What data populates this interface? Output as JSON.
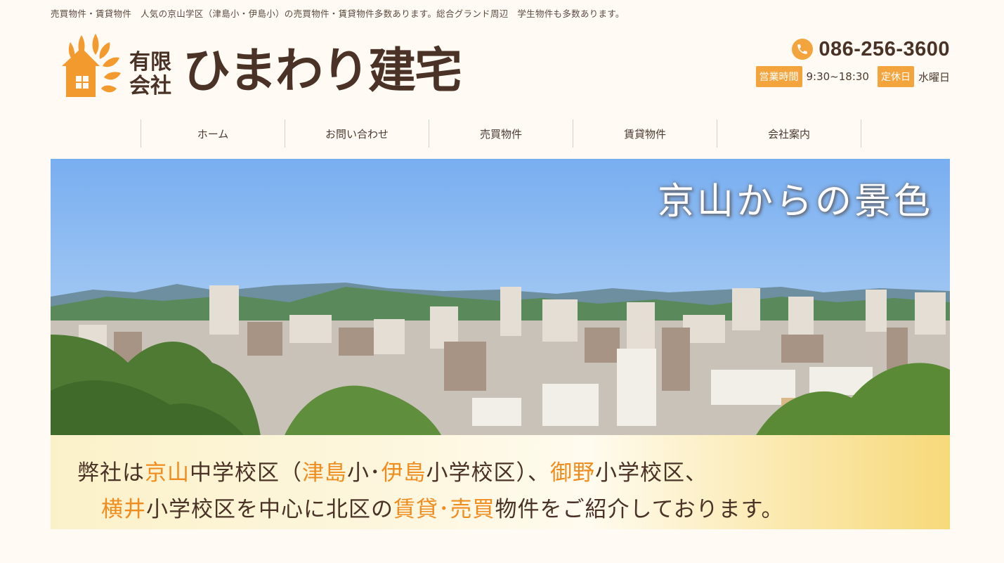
{
  "tagline": "売買物件・賃貸物件　人気の京山学区（津島小・伊島小）の売買物件・賃貸物件多数あります。総合グランド周辺　学生物件も多数あります。",
  "logo": {
    "small_line1": "有限",
    "small_line2": "会社",
    "name": "ひまわり建宅"
  },
  "contact": {
    "phone_icon": "phone-icon",
    "phone": "086-256-3600",
    "hours_label": "営業時間",
    "hours_value": "9:30~18:30",
    "holiday_label": "定休日",
    "holiday_value": "水曜日"
  },
  "nav": {
    "home": "ホーム",
    "contact": "お問い合わせ",
    "sale": "売買物件",
    "rental": "賃貸物件",
    "company": "会社案内"
  },
  "hero": {
    "title": "京山からの景色",
    "line1": [
      {
        "t": "弊社は",
        "hl": false
      },
      {
        "t": "京山",
        "hl": true
      },
      {
        "t": "中学校区（",
        "hl": false
      },
      {
        "t": "津島",
        "hl": true
      },
      {
        "t": "小･",
        "hl": false
      },
      {
        "t": "伊島",
        "hl": true
      },
      {
        "t": "小学校区）、",
        "hl": false
      },
      {
        "t": "御野",
        "hl": true
      },
      {
        "t": "小学校区、",
        "hl": false
      }
    ],
    "line2": [
      {
        "t": "横井",
        "hl": true
      },
      {
        "t": "小学校区を中心に北区の",
        "hl": false
      },
      {
        "t": "賃貸･売買",
        "hl": true
      },
      {
        "t": "物件をご紹介しております。",
        "hl": false
      }
    ]
  },
  "colors": {
    "accent": "#f4a43c",
    "highlight": "#f08c1e",
    "text": "#4a3226",
    "background": "#fffaf3"
  }
}
